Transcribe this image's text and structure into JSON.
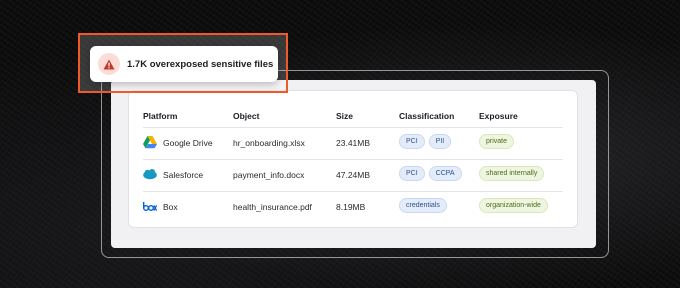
{
  "alert": {
    "icon": "warning-triangle-icon",
    "text": "1.7K overexposed sensitive files",
    "accent": "#ee5a2a"
  },
  "table": {
    "headers": {
      "platform": "Platform",
      "object": "Object",
      "size": "Size",
      "classification": "Classification",
      "exposure": "Exposure"
    },
    "rows": [
      {
        "platform": "Google Drive",
        "platform_icon": "google-drive-icon",
        "object": "hr_onboarding.xlsx",
        "size": "23.41MB",
        "classification": [
          "PCI",
          "PII"
        ],
        "exposure": "private"
      },
      {
        "platform": "Salesforce",
        "platform_icon": "salesforce-icon",
        "object": "payment_info.docx",
        "size": "47.24MB",
        "classification": [
          "PCI",
          "CCPA"
        ],
        "exposure": "shared internally"
      },
      {
        "platform": "Box",
        "platform_icon": "box-icon",
        "object": "health_insurance.pdf",
        "size": "8.19MB",
        "classification": [
          "credentials"
        ],
        "exposure": "organization-wide"
      }
    ]
  }
}
